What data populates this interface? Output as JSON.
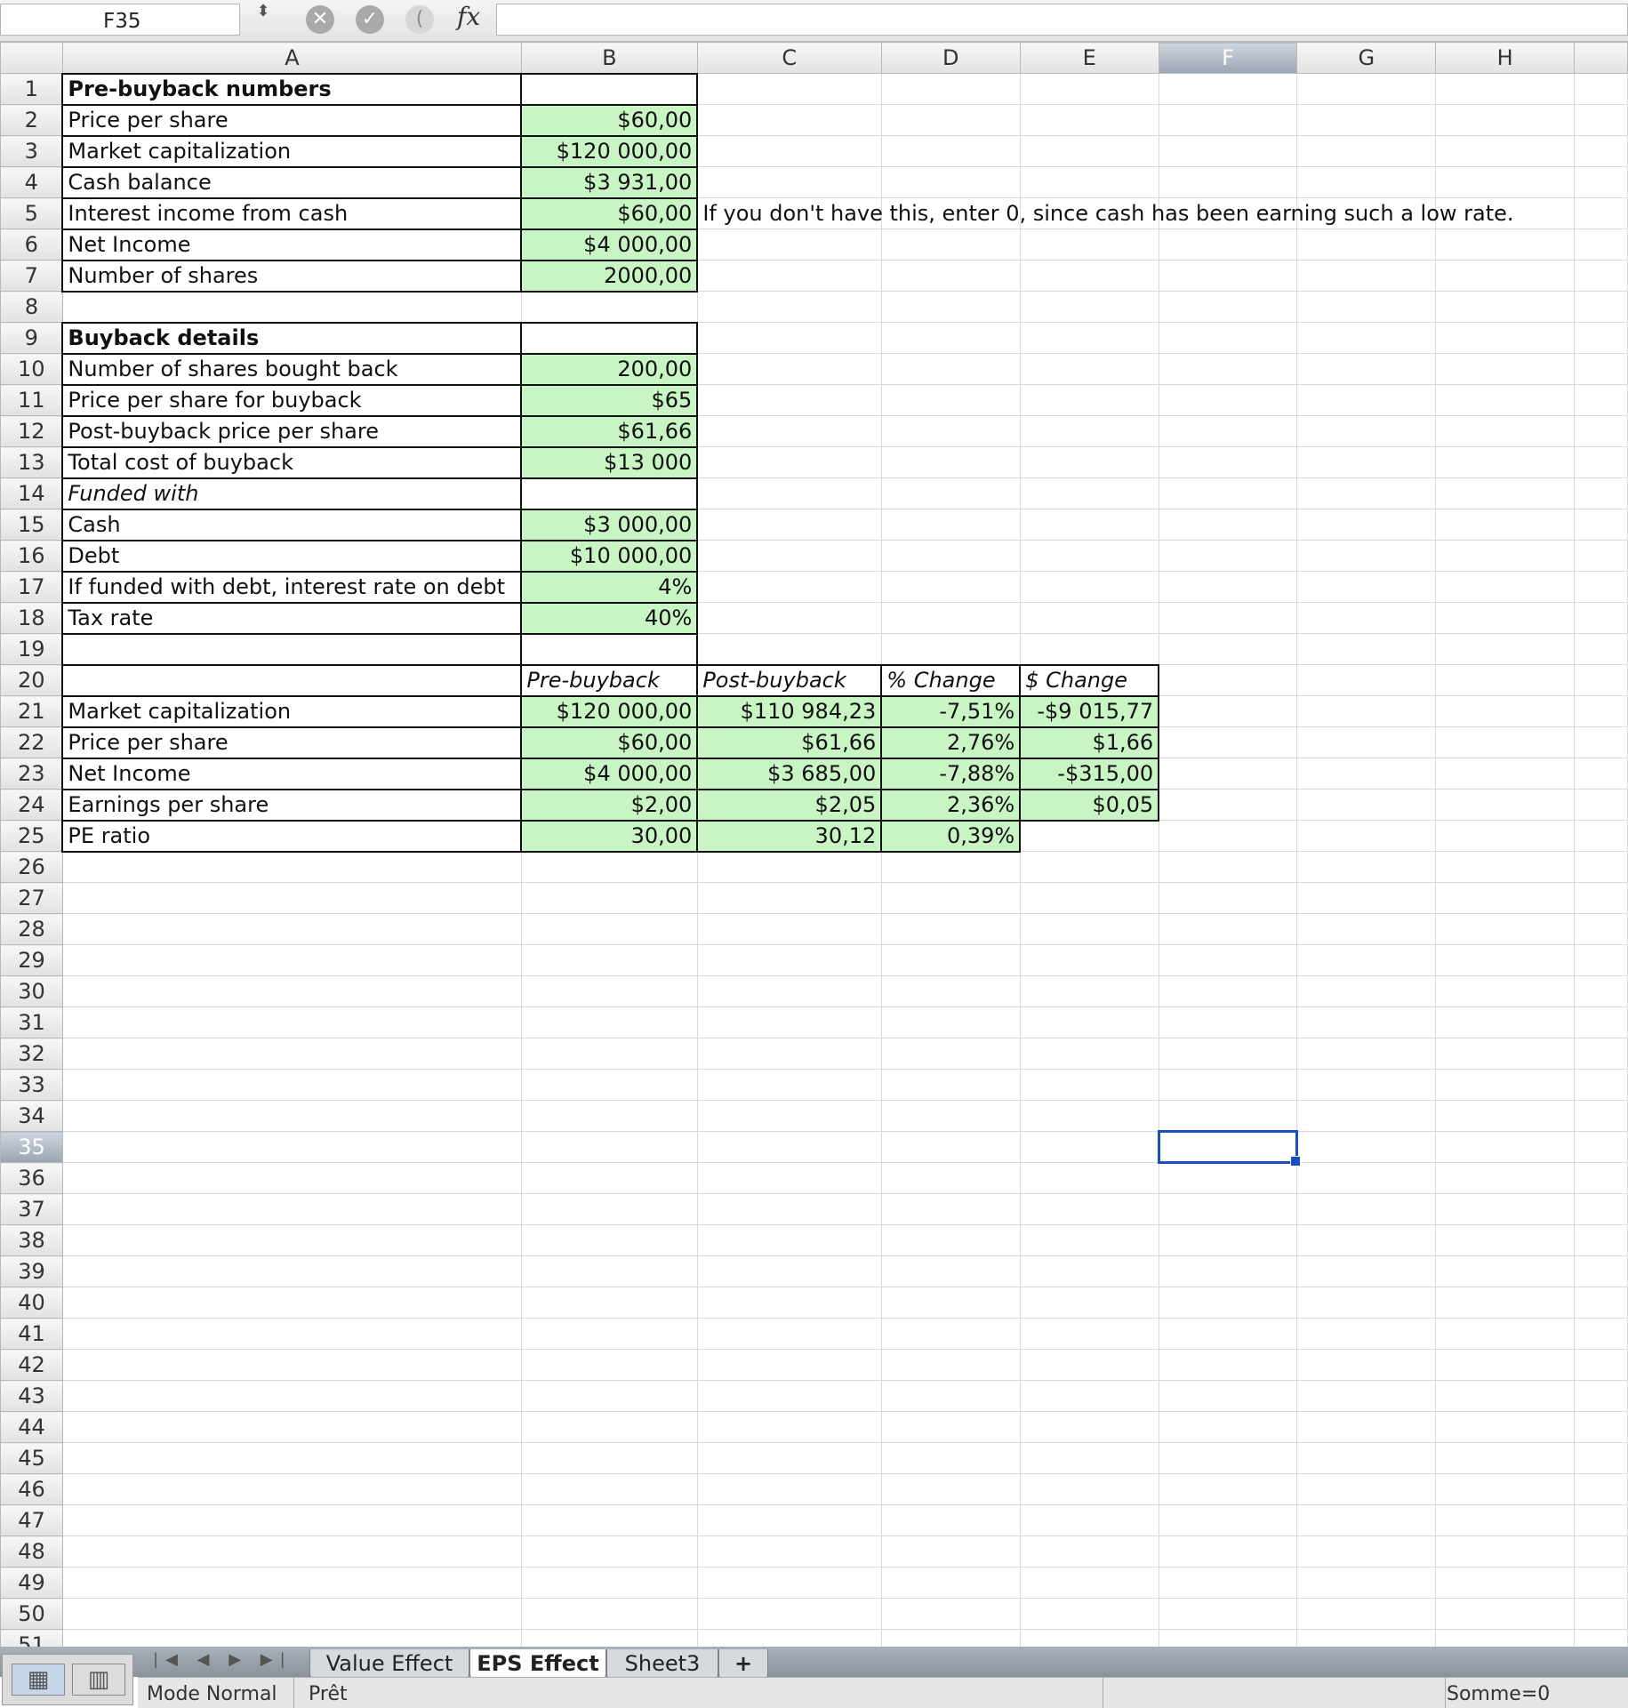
{
  "formula_bar": {
    "name_box": "F35",
    "spin_glyph": "⬍",
    "cancel_glyph": "✕",
    "confirm_glyph": "✓",
    "paren_glyph": "(",
    "fx_glyph": "fx",
    "formula": ""
  },
  "columns": [
    "A",
    "B",
    "C",
    "D",
    "E",
    "F",
    "G",
    "H"
  ],
  "active_column": "F",
  "active_row": 35,
  "rows": [
    {
      "n": 1,
      "a": "Pre-buyback numbers"
    },
    {
      "n": 2,
      "a": "Price per share",
      "b": "$60,00"
    },
    {
      "n": 3,
      "a": "Market capitalization",
      "b": "$120 000,00"
    },
    {
      "n": 4,
      "a": "Cash balance",
      "b": "$3 931,00"
    },
    {
      "n": 5,
      "a": "Interest income from cash",
      "b": "$60,00",
      "c": "If you don't have this, enter 0, since cash has been earning such a low rate."
    },
    {
      "n": 6,
      "a": "Net Income",
      "b": "$4 000,00"
    },
    {
      "n": 7,
      "a": "Number of shares",
      "b": "2000,00"
    },
    {
      "n": 8
    },
    {
      "n": 9,
      "a": "Buyback details"
    },
    {
      "n": 10,
      "a": "Number of shares bought back",
      "b": "200,00"
    },
    {
      "n": 11,
      "a": "Price per share for buyback",
      "b": "$65"
    },
    {
      "n": 12,
      "a": "Post-buyback price per share",
      "b": "$61,66"
    },
    {
      "n": 13,
      "a": "Total cost of buyback",
      "b": "$13 000"
    },
    {
      "n": 14,
      "a": "Funded with"
    },
    {
      "n": 15,
      "a": "Cash",
      "b": "$3 000,00"
    },
    {
      "n": 16,
      "a": "Debt",
      "b": "$10 000,00"
    },
    {
      "n": 17,
      "a": "If funded with debt, interest rate on debt",
      "b": "4%"
    },
    {
      "n": 18,
      "a": "Tax rate",
      "b": "40%"
    },
    {
      "n": 19
    },
    {
      "n": 20,
      "b": "Pre-buyback",
      "c": "Post-buyback",
      "d": "% Change",
      "e": "$ Change"
    },
    {
      "n": 21,
      "a": "Market capitalization",
      "b": "$120 000,00",
      "c": "$110 984,23",
      "d": "-7,51%",
      "e": "-$9 015,77"
    },
    {
      "n": 22,
      "a": "Price per share",
      "b": "$60,00",
      "c": "$61,66",
      "d": "2,76%",
      "e": "$1,66"
    },
    {
      "n": 23,
      "a": "Net Income",
      "b": "$4 000,00",
      "c": "$3 685,00",
      "d": "-7,88%",
      "e": "-$315,00"
    },
    {
      "n": 24,
      "a": "Earnings per share",
      "b": "$2,00",
      "c": "$2,05",
      "d": "2,36%",
      "e": "$0,05"
    },
    {
      "n": 25,
      "a": "PE ratio",
      "b": "30,00",
      "c": "30,12",
      "d": "0,39%"
    }
  ],
  "sheet_tabs": {
    "nav_arrows": "|◀ ◀ ▶ ▶|",
    "tabs": [
      "Value Effect",
      "EPS Effect",
      "Sheet3"
    ],
    "active": "EPS Effect",
    "add": "+"
  },
  "view_buttons": {
    "normal_glyph": "▦",
    "layout_glyph": "▥"
  },
  "status_bar": {
    "mode": "Mode Normal",
    "state": "Prêt",
    "sum": "Somme=0"
  },
  "colors": {
    "input_fill": "#c9f5c4",
    "selection": "#1a4fc3",
    "header_active": "#9aa4b2"
  }
}
